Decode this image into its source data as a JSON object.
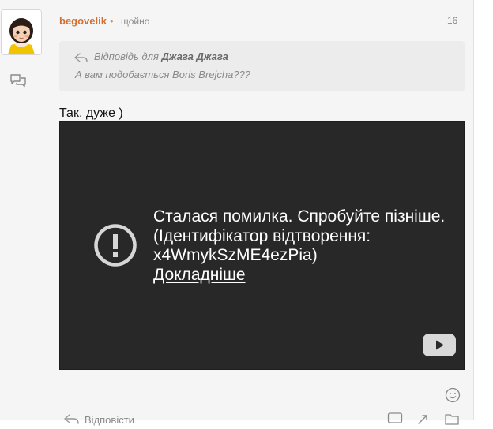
{
  "post": {
    "author": "begovelik",
    "online_dot": "•",
    "time": "щойно",
    "post_number": "16",
    "quote": {
      "prefix": "Відповідь для",
      "name": "Джага Джага",
      "text": "А вам подобається Boris Brejcha???"
    },
    "text": "Так, дуже )"
  },
  "video": {
    "error_message": "Сталася помилка. Спробуйте пізніше. (Ідентифікатор відтворення: x4WmykSzME4ezPia)",
    "more_link": "Докладніше"
  },
  "actions": {
    "reply_label": "Відповісти"
  },
  "icons": {
    "avatar": "cartoon-doll-avatar",
    "replies": "speech-bubbles-icon",
    "quote": "reply-arrow-icon",
    "error": "exclamation-circle-icon",
    "video_play": "youtube-play-icon",
    "emoji": "smiley-icon",
    "comment": "comment-icon",
    "share": "share-icon",
    "bookmark": "bookmark-icon"
  },
  "colors": {
    "author": "#d3702f",
    "background": "#f5f5f5",
    "video_background": "#282828"
  }
}
